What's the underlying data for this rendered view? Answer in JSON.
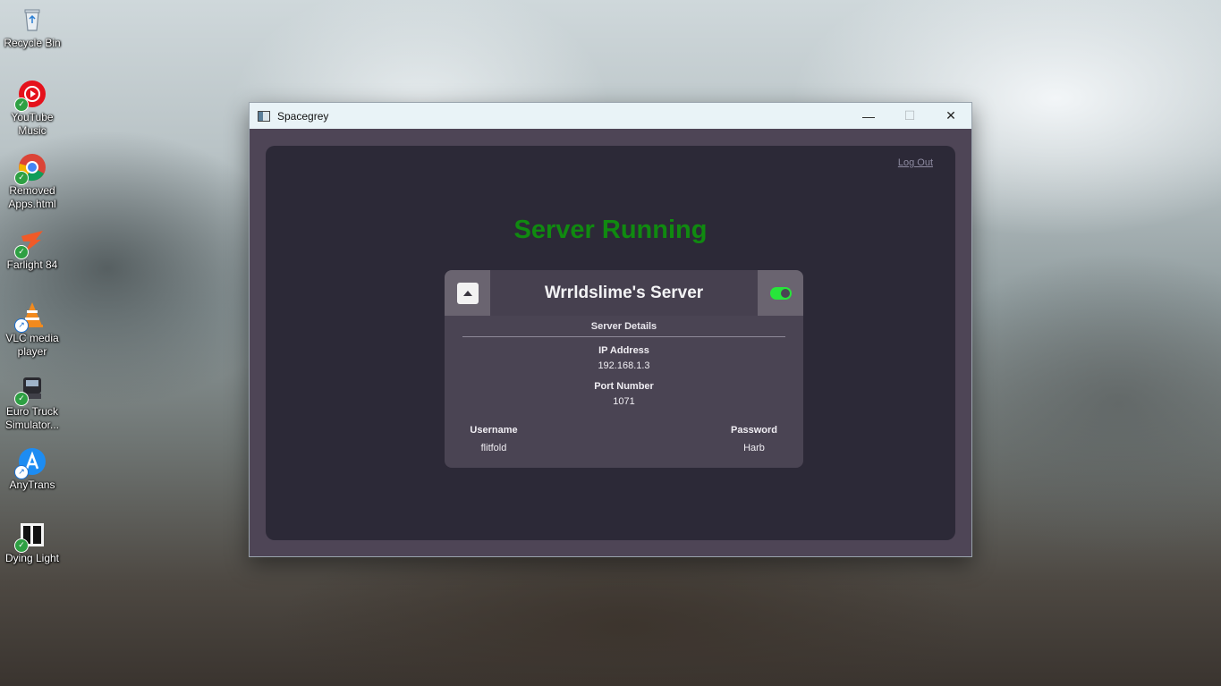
{
  "desktop": {
    "icons": [
      {
        "label": "Recycle Bin",
        "icon": "recycle-bin-icon"
      },
      {
        "label": "YouTube Music",
        "icon": "youtube-music-icon"
      },
      {
        "label": "Removed Apps.html",
        "icon": "chrome-icon"
      },
      {
        "label": "Farlight 84",
        "icon": "farlight-icon"
      },
      {
        "label": "VLC media player",
        "icon": "vlc-icon"
      },
      {
        "label": "Euro Truck Simulator...",
        "icon": "truck-icon"
      },
      {
        "label": "AnyTrans",
        "icon": "anytrans-icon"
      },
      {
        "label": "Dying Light",
        "icon": "dying-light-icon"
      }
    ]
  },
  "window": {
    "title": "Spacegrey",
    "controls": {
      "minimize": "—",
      "maximize": "☐",
      "close": "✕"
    }
  },
  "app": {
    "logout_label": "Log Out",
    "status": "Server Running",
    "status_color": "#108a10",
    "server": {
      "name": "Wrrldslime's Server",
      "toggle_on": true,
      "details_heading": "Server Details",
      "ip_label": "IP Address",
      "ip_value": "192.168.1.3",
      "port_label": "Port Number",
      "port_value": "1071",
      "username_label": "Username",
      "username_value": "flitfold",
      "password_label": "Password",
      "password_value": "Harb"
    }
  }
}
